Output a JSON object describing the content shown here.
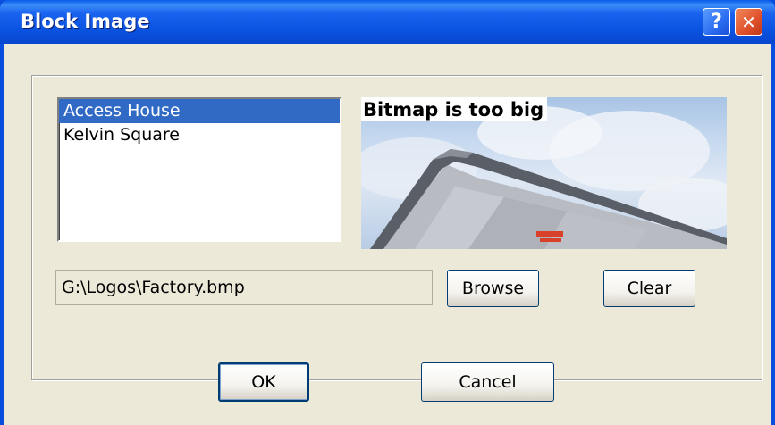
{
  "window": {
    "title": "Block Image",
    "help_glyph": "?",
    "close_glyph": "✕"
  },
  "list": {
    "items": [
      "Access House",
      "Kelvin Square"
    ],
    "selected_index": 0
  },
  "preview": {
    "message": "Bitmap is too big"
  },
  "path": {
    "value": "G:\\Logos\\Factory.bmp"
  },
  "buttons": {
    "browse": "Browse",
    "clear": "Clear",
    "ok": "OK",
    "cancel": "Cancel"
  },
  "colors": {
    "titlebar": "#0a52e0",
    "dialog_face": "#ece9d8",
    "selection": "#316ac5"
  }
}
